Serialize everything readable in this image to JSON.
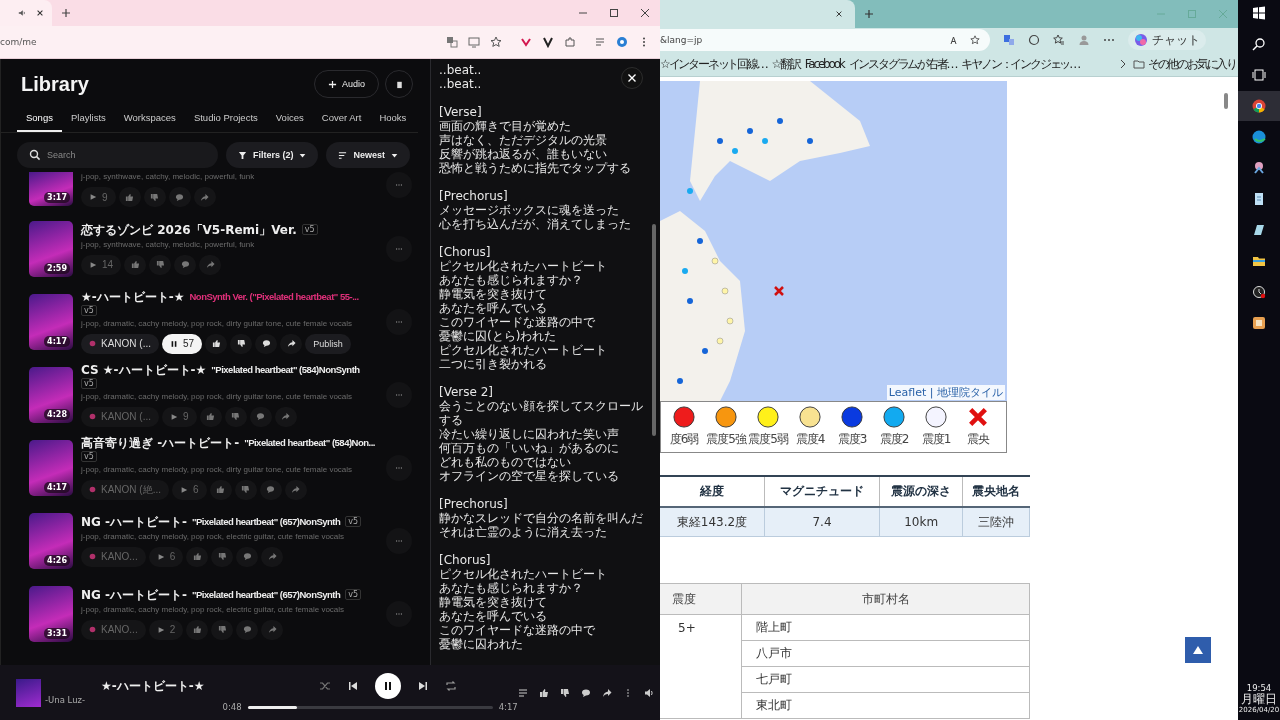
{
  "left_browser": {
    "address": "com/me"
  },
  "library": {
    "title": "Library",
    "add_label": "Audio",
    "tabs": [
      {
        "label": "Songs",
        "selected": true
      },
      {
        "label": "Playlists",
        "selected": false
      },
      {
        "label": "Workspaces",
        "selected": false
      },
      {
        "label": "Studio Projects",
        "selected": false
      },
      {
        "label": "Voices",
        "selected": false
      },
      {
        "label": "Cover Art",
        "selected": false
      },
      {
        "label": "Hooks",
        "selected": false
      }
    ],
    "search": {
      "placeholder": "Search"
    },
    "filter": "Filters (2)",
    "sort": "Newest",
    "songs": [
      {
        "tags": "j-pop, synthwave, catchy, melodic, powerful, funk",
        "duration": "3:17",
        "plays": "9",
        "playing": false
      },
      {
        "title": "恋するゾンビ 2026「V5-Remi」Ver.",
        "version": "v5",
        "tags": "j-pop, synthwave, catchy, melodic, powerful, funk",
        "duration": "2:59",
        "plays": "14",
        "playing": false
      },
      {
        "title": "★-ハートビート-★",
        "subtitle": "NonSynth Ver. (\"Pixelated heartbeat\" 55-...",
        "version": "v5",
        "tags": "j-pop, dramatic, cachy melody, pop rock, dirty guitar tone, cute female vocals",
        "duration": "4:17",
        "artist": "KANON (...",
        "plays": "57",
        "playing": true,
        "publish": "Publish"
      },
      {
        "title": "CS ★-ハートビート-★",
        "subtitle": "\"Pixelated heartbeat\" (584)NonSynth",
        "version": "v5",
        "tags": "j-pop, dramatic, cachy melody, pop rock, dirty guitar tone, cute female vocals",
        "duration": "4:28",
        "artist": "KANON (...",
        "plays": "9",
        "playing": false
      },
      {
        "title": "高音寄り過ぎ -ハートビート-",
        "subtitle": "\"Pixelated heartbeat\" (584)Non...",
        "version": "v5",
        "tags": "j-pop, dramatic, cachy melody, pop rock, dirty guitar tone, cute female vocals",
        "duration": "4:17",
        "artist": "KANON (絶...",
        "plays": "6",
        "playing": false
      },
      {
        "title": "NG -ハートビート-",
        "subtitle": "\"Pixelated heartbeat\" (657)NonSynth",
        "version": "v5",
        "tags": "j-pop, dramatic, cachy melody, pop rock, electric guitar, cute female vocals",
        "duration": "4:26",
        "artist": "KANO...",
        "plays": "6",
        "playing": false
      },
      {
        "title": "NG -ハートビート-",
        "subtitle": "\"Pixelated heartbeat\" (657)NonSynth",
        "version": "v5",
        "tags": "j-pop, dramatic, cachy melody, pop rock, electric guitar, cute female vocals",
        "duration": "3:31",
        "artist": "KANO...",
        "plays": "2",
        "playing": false
      }
    ]
  },
  "lyrics": [
    [
      "..beat..",
      "..beat.."
    ],
    [
      "[Verse]",
      "画面の輝きで目が覚めた",
      "声はなく、ただデジタルの光景",
      "反響が跳ね返るが、誰もいない",
      "恐怖と戦うために指先でタップする"
    ],
    [
      "[Prechorus]",
      "メッセージボックスに魂を送った",
      "心を打ち込んだが、消えてしまった"
    ],
    [
      "[Chorus]",
      "ピクセル化されたハートビート",
      "あなたも感じられますか？",
      "静電気を突き抜けて",
      "あなたを呼んでいる",
      "このワイヤードな迷路の中で",
      "憂鬱に囚(とら)われた",
      "ピクセル化されたハートビート",
      "二つに引き裂かれる"
    ],
    [
      "[Verse 2]",
      "会うことのない顔を探してスクロールする",
      "冷たい繰り返しに囚われた笑い声",
      "何百万もの「いいね」があるのに",
      "どれも私のものではない",
      "オフラインの空で星を探している"
    ],
    [
      "[Prechorus]",
      "静かなスレッドで自分の名前を叫んだ",
      "それは亡霊のように消え去った"
    ],
    [
      "[Chorus]",
      "ピクセル化されたハートビート",
      "あなたも感じられますか？",
      "静電気を突き抜けて",
      "あなたを呼んでいる",
      "このワイヤードな迷路の中で",
      "憂鬱に囚われた"
    ]
  ],
  "player": {
    "title": "★-ハートビート-★",
    "artist": "-Una Luz-",
    "elapsed": "0:48",
    "total": "4:17",
    "level": 0.2,
    "playing": true
  },
  "right_browser": {
    "address": "&lang=jp",
    "chat_label": "チャット",
    "bookmarks": [
      "☆インターネット回線…",
      "☆翻訳",
      "Facebook",
      "インスタグラムが右者…",
      "キヤノン：インクジェッ…"
    ],
    "more_bookmarks": "その他のお気に入り"
  },
  "map": {
    "attribution": "Leaflet | 地理院タイル",
    "legend": [
      {
        "label": "度6弱",
        "color": "#ee1c1c",
        "kind": "dot"
      },
      {
        "label": "震度5強",
        "color": "#f7960f",
        "kind": "dot"
      },
      {
        "label": "震度5弱",
        "color": "#fff01a",
        "kind": "dot"
      },
      {
        "label": "震度4",
        "color": "#f8e291",
        "kind": "dot"
      },
      {
        "label": "震度3",
        "color": "#0a3ae0",
        "kind": "dot"
      },
      {
        "label": "震度2",
        "color": "#12aaf0",
        "kind": "dot"
      },
      {
        "label": "震度1",
        "color": "#f4f4ff",
        "kind": "dot"
      },
      {
        "label": "震央",
        "color": "#e01010",
        "kind": "cross"
      }
    ]
  },
  "quake_table": {
    "columns": [
      "経度",
      "マグニチュード",
      "震源の深さ",
      "震央地名"
    ],
    "rows": [
      [
        "東経143.2度",
        "7.4",
        "10km",
        "三陸沖"
      ]
    ]
  },
  "intensity_table": {
    "columns": [
      "震度",
      "市町村名"
    ],
    "groups": [
      {
        "intensity": "5+",
        "towns": [
          "階上町",
          "八戸市",
          "七戸町",
          "東北町"
        ]
      }
    ]
  },
  "taskbar": {
    "time": "19:54",
    "day": "月曜日",
    "date": "2026/04/20"
  }
}
